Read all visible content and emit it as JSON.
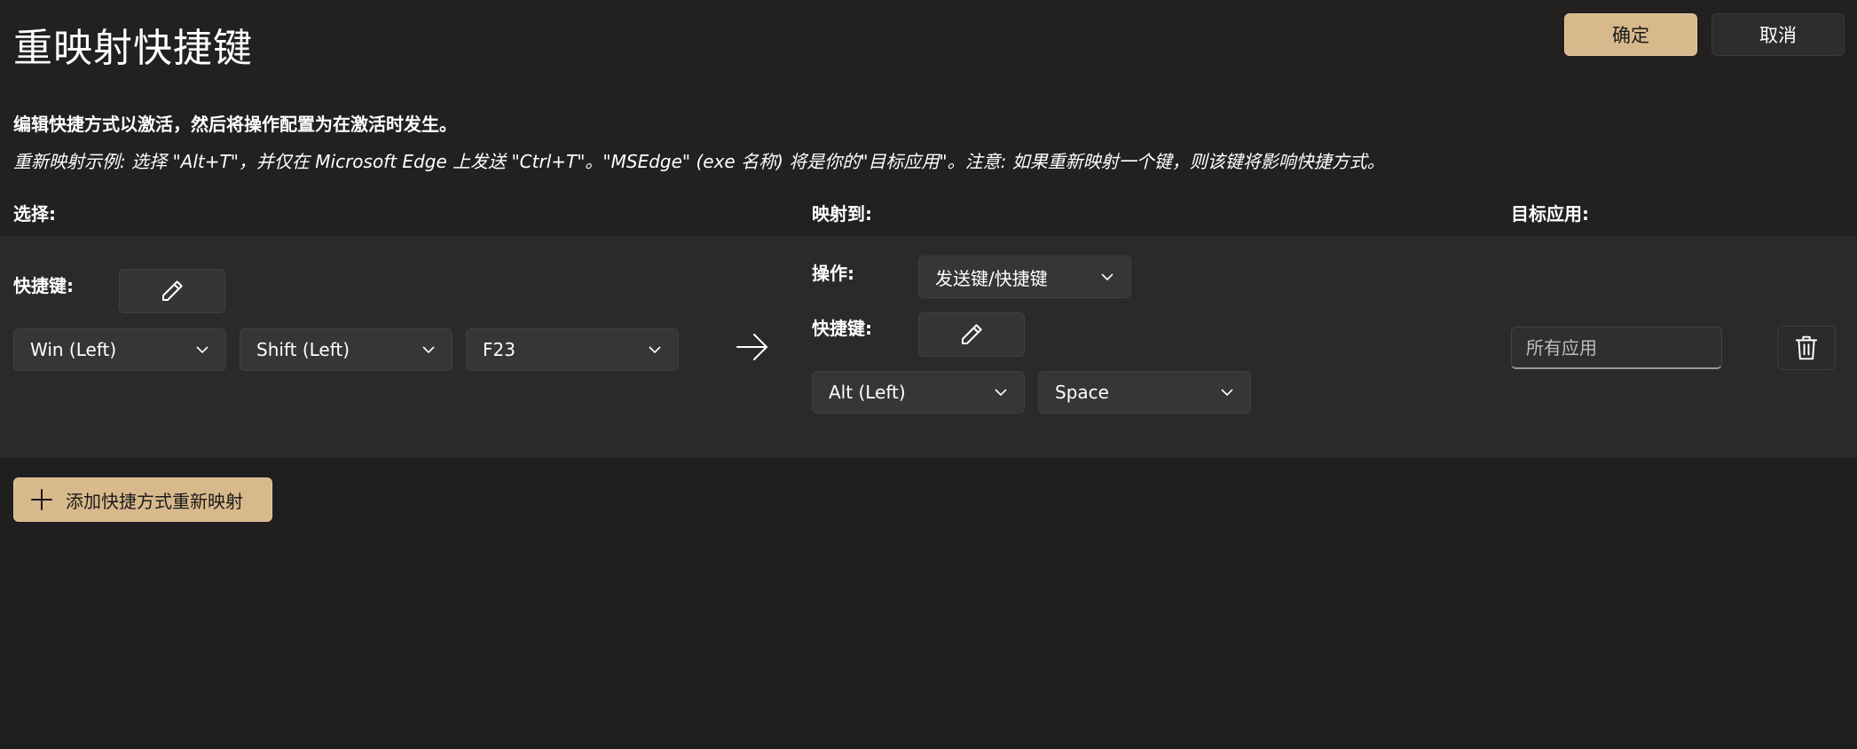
{
  "header": {
    "title": "重映射快捷键",
    "ok_label": "确定",
    "cancel_label": "取消"
  },
  "description": {
    "line1": "编辑快捷方式以激活，然后将操作配置为在激活时发生。",
    "line2": "重新映射示例: 选择 \"Alt+T\"，并仅在 Microsoft Edge 上发送 \"Ctrl+T\"。\"MSEdge\" (exe 名称) 将是你的\"目标应用\"。注意: 如果重新映射一个键，则该键将影响快捷方式。"
  },
  "columns": {
    "select": "选择:",
    "map_to": "映射到:",
    "target_app": "目标应用:"
  },
  "row": {
    "source": {
      "shortcut_label": "快捷键:",
      "keys": [
        "Win (Left)",
        "Shift (Left)",
        "F23"
      ]
    },
    "target": {
      "action_label": "操作:",
      "action_value": "发送键/快捷键",
      "shortcut_label": "快捷键:",
      "keys": [
        "Alt (Left)",
        "Space"
      ]
    },
    "target_app_placeholder": "所有应用"
  },
  "add_button_label": "添加快捷方式重新映射",
  "colors": {
    "accent": "#d8b98c",
    "background": "#1f1f1f",
    "panel": "#2a2a2a",
    "control": "#363636"
  },
  "icons": {
    "edit": "pencil-icon",
    "arrow": "arrow-right-icon",
    "delete": "trash-icon",
    "add": "plus-icon",
    "dropdown": "chevron-down-icon"
  }
}
